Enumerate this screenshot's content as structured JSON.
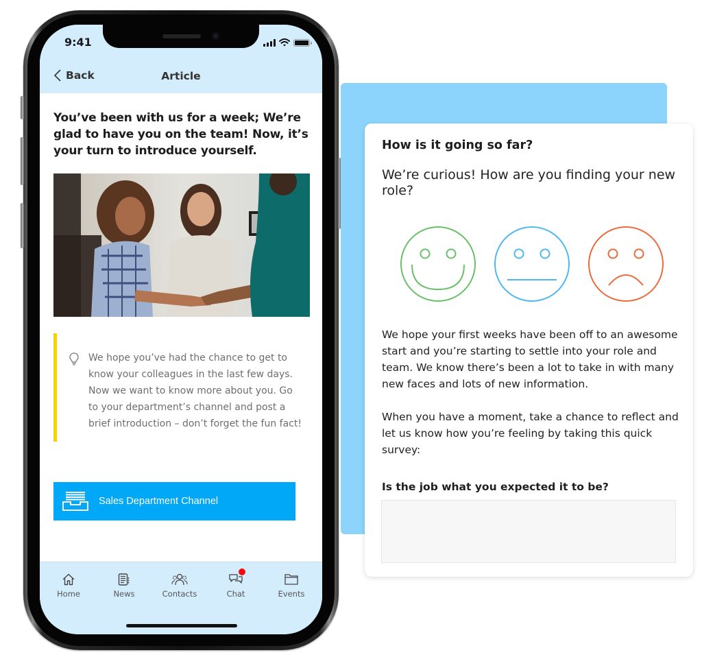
{
  "phone": {
    "status_bar": {
      "time": "9:41"
    },
    "nav": {
      "back_label": "Back",
      "title": "Article"
    },
    "article": {
      "headline": "You’ve been with us for a week; We’re glad to have you on the team! Now, it’s your turn to introduce yourself.",
      "photo_alt": "Colleagues shaking hands and smiling",
      "tip_text": "We hope you’ve had the chance to get to know your colleagues in the last few days. Now we want to know more about you. Go to your department’s channel and post a brief introduction – don’t forget the fun fact!",
      "channel_button_label": "Sales Department Channel"
    },
    "tabs": [
      {
        "label": "Home",
        "icon": "home-icon",
        "badge": false
      },
      {
        "label": "News",
        "icon": "news-icon",
        "badge": false
      },
      {
        "label": "Contacts",
        "icon": "contacts-icon",
        "badge": false
      },
      {
        "label": "Chat",
        "icon": "chat-icon",
        "badge": true
      },
      {
        "label": "Events",
        "icon": "folder-icon",
        "badge": false
      }
    ]
  },
  "survey": {
    "title": "How is it going so far?",
    "subtitle": "We’re curious! How are you finding your new role?",
    "faces": [
      {
        "mood": "happy",
        "color": "#6abf69"
      },
      {
        "mood": "neutral",
        "color": "#4fb8f2"
      },
      {
        "mood": "sad",
        "color": "#ec6a3c"
      }
    ],
    "body_paragraphs": [
      "We hope your first weeks have been off to an awesome start and you’re starting to settle into your role and team. We know there’s been a lot to take in with many new faces and lots of new information.",
      "When you have a moment, take a chance to reflect and let us know how you’re feeling by taking this quick survey:"
    ],
    "question_label": "Is the job what you expected it to be?",
    "answer_value": "",
    "answer_placeholder": ""
  },
  "colors": {
    "header_bg": "#d3edfd",
    "accent_blue": "#00a8f7",
    "tip_bar": "#f7d400",
    "card_back": "#8cd4fc",
    "badge_red": "#f00c0c"
  }
}
